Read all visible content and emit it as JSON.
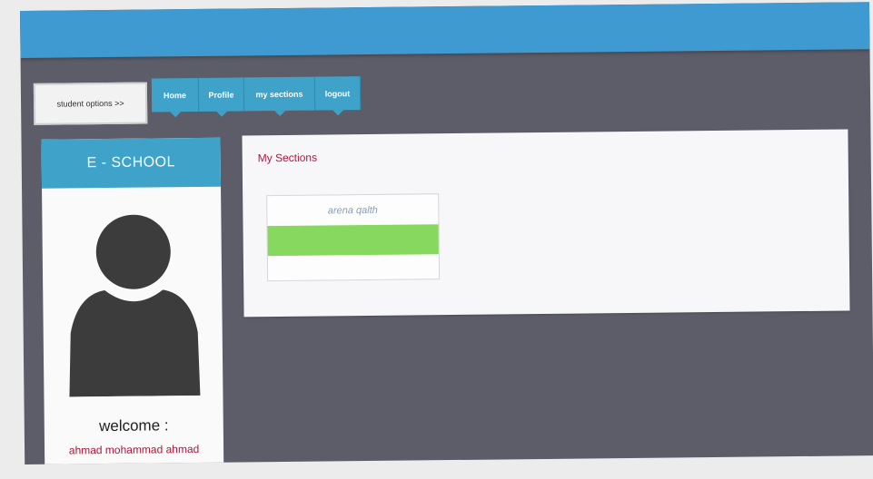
{
  "student_options": {
    "label": "student options >>"
  },
  "nav": {
    "items": [
      {
        "label": "Home"
      },
      {
        "label": "Profile"
      },
      {
        "label": "my sections"
      },
      {
        "label": "logout"
      }
    ]
  },
  "sidebar": {
    "title": "E - SCHOOL",
    "welcome": "welcome :",
    "username": "ahmad mohammad ahmad"
  },
  "main": {
    "section_title": "My Sections",
    "sections": [
      {
        "name": "arena qalth",
        "status": ""
      }
    ]
  },
  "colors": {
    "banner": "#3e9ad1",
    "nav": "#3ea2c9",
    "background": "#5c5d69",
    "accent_text": "#b3163a",
    "progress": "#86d85f"
  }
}
